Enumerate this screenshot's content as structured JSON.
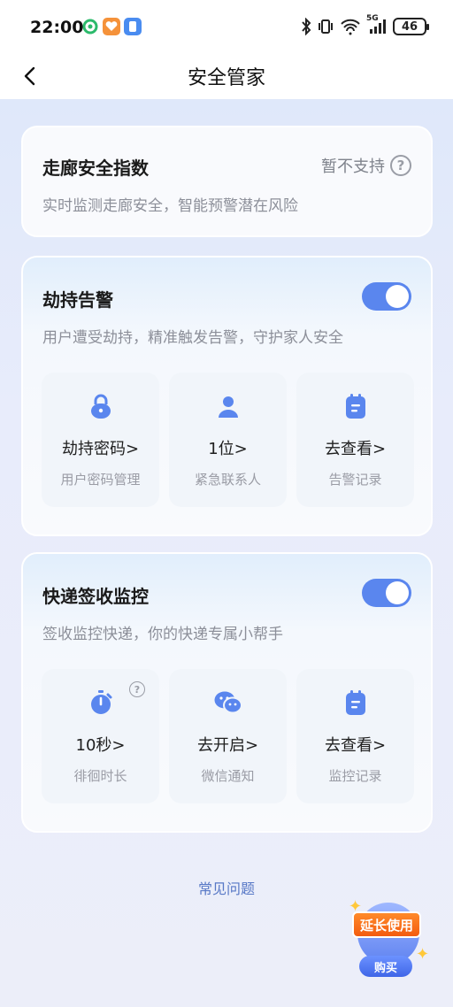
{
  "status_bar": {
    "time": "22:00",
    "network": "5G",
    "battery": "46",
    "icons": [
      "wechat-mini-icon",
      "heart-app-icon",
      "app-badge-icon",
      "bluetooth-icon",
      "vibrate-icon",
      "wifi-icon",
      "signal-icon",
      "battery-icon"
    ]
  },
  "nav": {
    "title": "安全管家"
  },
  "corridor": {
    "title": "走廊安全指数",
    "status": "暂不支持",
    "desc": "实时监测走廊安全，智能预警潜在风险"
  },
  "hijack": {
    "title": "劫持告警",
    "desc": "用户遭受劫持，精准触发告警，守护家人安全",
    "toggle_on": true,
    "tiles": [
      {
        "icon": "lock-icon",
        "main": "劫持密码>",
        "sub": "用户密码管理"
      },
      {
        "icon": "person-icon",
        "main": "1位>",
        "sub": "紧急联系人"
      },
      {
        "icon": "clipboard-icon",
        "main": "去查看>",
        "sub": "告警记录"
      }
    ]
  },
  "delivery": {
    "title": "快递签收监控",
    "desc": "签收监控快递，你的快递专属小帮手",
    "toggle_on": true,
    "tiles": [
      {
        "icon": "stopwatch-icon",
        "main": "10秒>",
        "sub": "徘徊时长"
      },
      {
        "icon": "wechat-icon",
        "main": "去开启>",
        "sub": "微信通知"
      },
      {
        "icon": "clipboard-icon",
        "main": "去查看>",
        "sub": "监控记录"
      }
    ]
  },
  "faq": {
    "label": "常见问题"
  },
  "promo": {
    "tag": "延长使用",
    "button": "购买"
  },
  "colors": {
    "accent": "#5a86ee",
    "link": "#5778c6",
    "promo_orange": "#f35c10"
  }
}
